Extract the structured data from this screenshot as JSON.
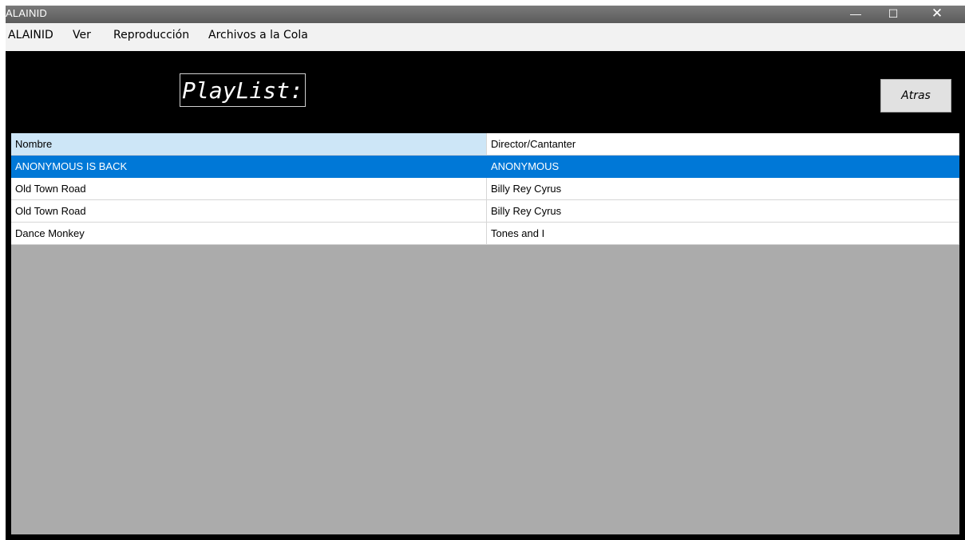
{
  "window": {
    "title": "ALAINID",
    "minimize_glyph": "—",
    "maximize_glyph": "☐",
    "close_glyph": "✕"
  },
  "menu": {
    "items": [
      "ALAINID",
      "Ver",
      "Reproducción",
      "Archivos a la Cola"
    ]
  },
  "toolbar": {
    "title": "PlayList:",
    "back_label": "Atras"
  },
  "table": {
    "columns": [
      "Nombre",
      "Director/Cantanter"
    ],
    "rows": [
      [
        "ANONYMOUS IS BACK",
        "ANONYMOUS"
      ],
      [
        "Old Town Road",
        "Billy Rey Cyrus"
      ],
      [
        "Old Town Road",
        "Billy Rey Cyrus"
      ],
      [
        "Dance Monkey",
        "Tones and I"
      ]
    ],
    "selected_row": 0
  },
  "colors": {
    "selection": "#0078d7",
    "header_highlight": "#cde6f7",
    "grid_background": "#ababab",
    "window_background": "#000000"
  }
}
